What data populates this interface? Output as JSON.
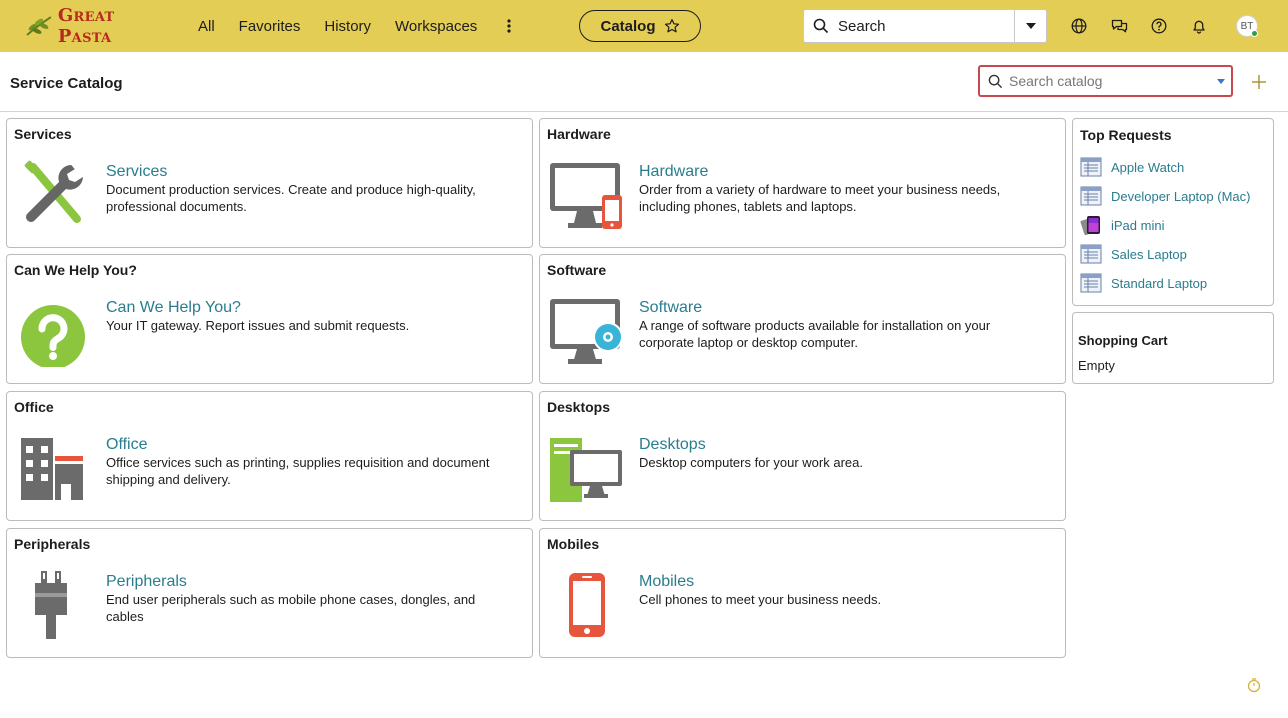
{
  "brand": {
    "name": "Great Pasta"
  },
  "nav": {
    "links": [
      "All",
      "Favorites",
      "History",
      "Workspaces"
    ],
    "catalog_pill": "Catalog",
    "search_label": "Search",
    "user_initials": "BT"
  },
  "page": {
    "title": "Service Catalog",
    "search_placeholder": "Search catalog"
  },
  "categories": [
    {
      "heading": "Services",
      "title": "Services",
      "description": "Document production services. Create and produce high-quality, professional documents.",
      "icon": "tools-icon"
    },
    {
      "heading": "Hardware",
      "title": "Hardware",
      "description": "Order from a variety of hardware to meet your business needs, including phones, tablets and laptops.",
      "icon": "hardware-icon"
    },
    {
      "heading": "Can We Help You?",
      "title": "Can We Help You?",
      "description": "Your IT gateway. Report issues and submit requests.",
      "icon": "question-icon"
    },
    {
      "heading": "Software",
      "title": "Software",
      "description": "A range of software products available for installation on your corporate laptop or desktop computer.",
      "icon": "software-icon"
    },
    {
      "heading": "Office",
      "title": "Office",
      "description": "Office services such as printing, supplies requisition and document shipping and delivery.",
      "icon": "office-building-icon"
    },
    {
      "heading": "Desktops",
      "title": "Desktops",
      "description": "Desktop computers for your work area.",
      "icon": "desktop-icon"
    },
    {
      "heading": "Peripherals",
      "title": "Peripherals",
      "description": "End user peripherals such as mobile phone cases, dongles, and cables",
      "icon": "plug-icon"
    },
    {
      "heading": "Mobiles",
      "title": "Mobiles",
      "description": "Cell phones to meet your business needs.",
      "icon": "mobile-phone-icon"
    }
  ],
  "top_requests": {
    "title": "Top Requests",
    "items": [
      {
        "label": "Apple Watch",
        "icon": "catalog-item-icon"
      },
      {
        "label": "Developer Laptop (Mac)",
        "icon": "catalog-item-icon"
      },
      {
        "label": "iPad mini",
        "icon": "ipad-icon"
      },
      {
        "label": "Sales Laptop",
        "icon": "catalog-item-icon"
      },
      {
        "label": "Standard Laptop",
        "icon": "catalog-item-icon"
      }
    ]
  },
  "shopping_cart": {
    "title": "Shopping Cart",
    "status": "Empty"
  },
  "colors": {
    "header": "#e4cd55",
    "link": "#2a7d8e",
    "search_focus_border": "#c7484e"
  }
}
